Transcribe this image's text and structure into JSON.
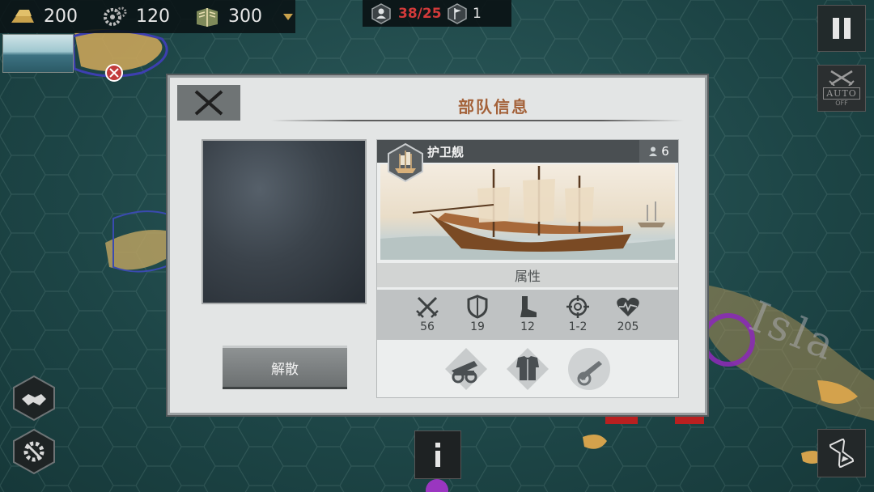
{
  "resources": [
    {
      "icon": "gold-bars-icon",
      "value": "200"
    },
    {
      "icon": "gear-industry-icon",
      "value": "120"
    },
    {
      "icon": "manpower-book-icon",
      "value": "300"
    }
  ],
  "status_bar": {
    "units": "38/25",
    "flags": "1"
  },
  "right_controls": {
    "auto_label": "AUTO",
    "auto_state": "OFF"
  },
  "map": {
    "label": "Isla"
  },
  "dialog": {
    "title": "部队信息",
    "disband_label": "解散",
    "unit": {
      "name": "护卫舰",
      "crew": "6",
      "attributes_title": "属性",
      "stats": [
        {
          "icon": "attack-swords-icon",
          "value": "56"
        },
        {
          "icon": "defense-shield-icon",
          "value": "19"
        },
        {
          "icon": "movement-boot-icon",
          "value": "12"
        },
        {
          "icon": "range-crosshair-icon",
          "value": "1-2"
        },
        {
          "icon": "health-heart-icon",
          "value": "205"
        }
      ],
      "equipment": [
        "cannon-upgrade-icon",
        "armor-upgrade-icon",
        "mortar-upgrade-icon"
      ]
    }
  },
  "colors": {
    "title_accent": "#a4623a",
    "unit_count_over": "#d23a3a"
  }
}
